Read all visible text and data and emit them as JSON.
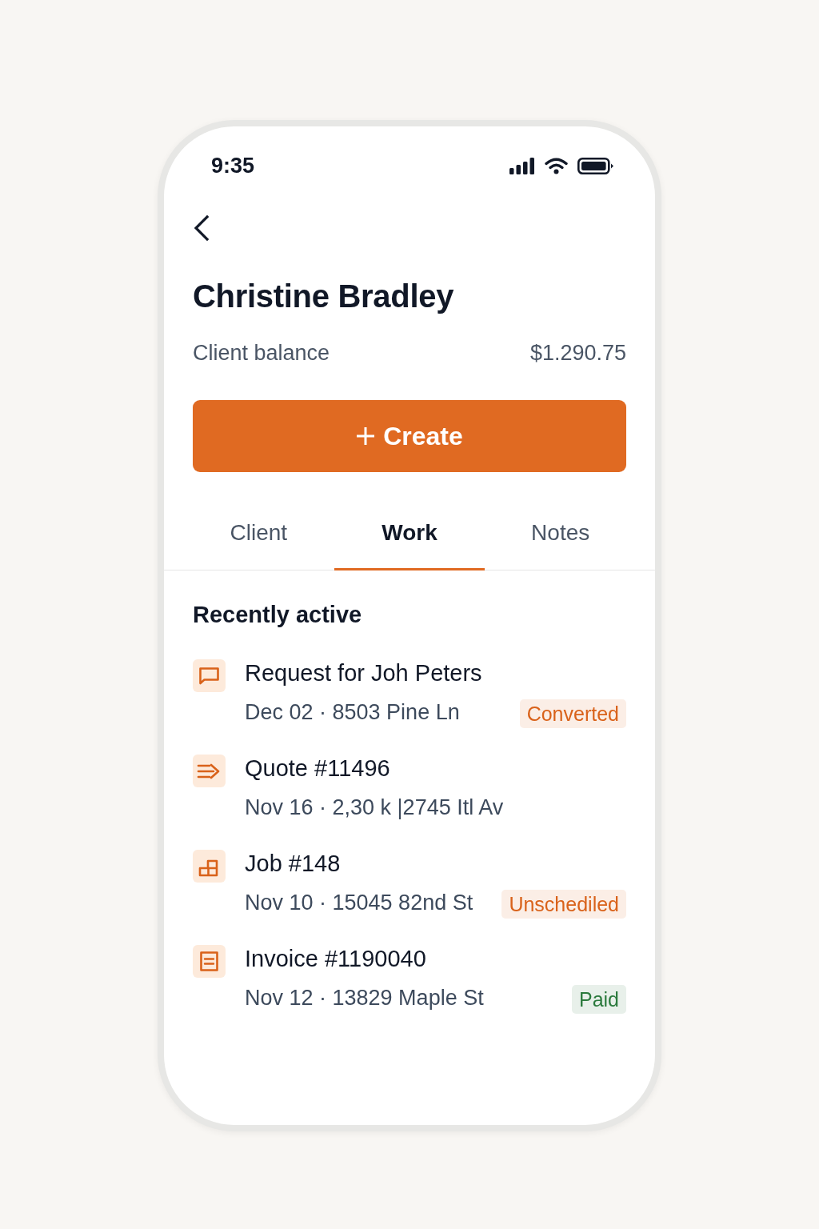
{
  "status_bar": {
    "time": "9:35"
  },
  "header": {
    "title": "Christine Bradley",
    "balance_label": "Client balance",
    "balance": "$1.290.75"
  },
  "create_button": {
    "label": "Create"
  },
  "tabs": [
    {
      "label": "Client",
      "selected": false
    },
    {
      "label": "Work",
      "selected": true
    },
    {
      "label": "Notes",
      "selected": false
    }
  ],
  "section": {
    "title": "Recently active",
    "items": [
      {
        "kind": "request",
        "title": "Request for Joh Peters",
        "subtitle": "Dec 02 · 8503 Pine Ln",
        "badge": {
          "label": "Converted",
          "color": "#d9621a"
        }
      },
      {
        "kind": "quote",
        "title": "Quote #11496",
        "subtitle": "Nov 16 · 2,30 k |2745 Itl Av"
      },
      {
        "kind": "job",
        "title": "Job #148",
        "subtitle": "Nov 10 · 15045 82nd St",
        "badge": {
          "label": "Unschediled",
          "color": "#d9621a"
        }
      },
      {
        "kind": "invoice",
        "title": "Invoice #1190040",
        "subtitle": "Nov 12 · 13829 Maple St",
        "badge": {
          "label": "Paid",
          "color": "#2b7a3d"
        }
      }
    ]
  }
}
